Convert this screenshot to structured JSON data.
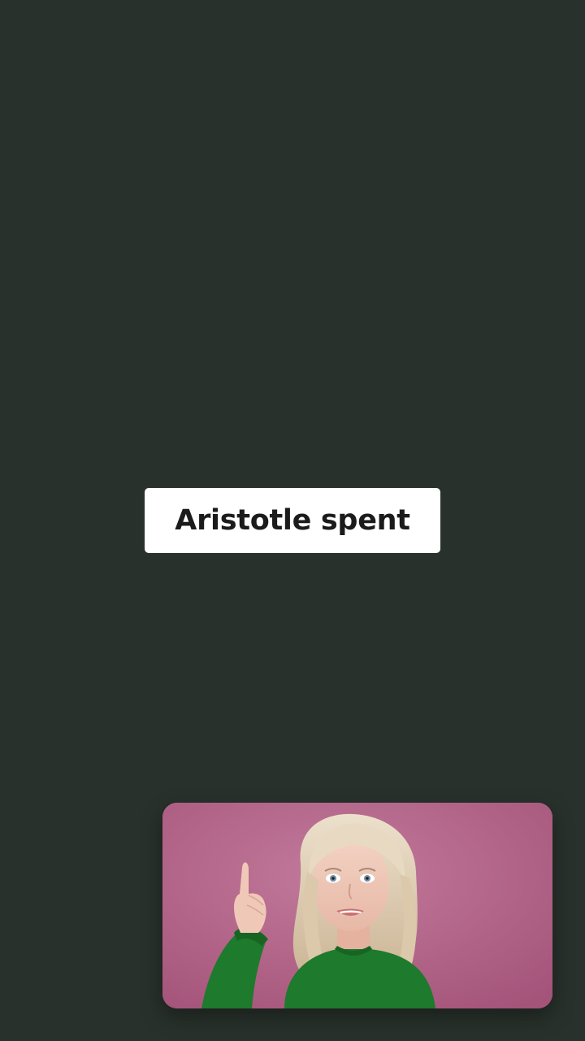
{
  "caption": {
    "text": "Aristotle spent"
  },
  "video_overlay": {
    "icon": "presenter-video"
  },
  "colors": {
    "background": "#28312b",
    "caption_background": "#ffffff",
    "caption_text": "#1b1b1b",
    "video_background": "#b6678c",
    "sweater": "#1e7a2c",
    "hair": "#e2d2b7"
  }
}
